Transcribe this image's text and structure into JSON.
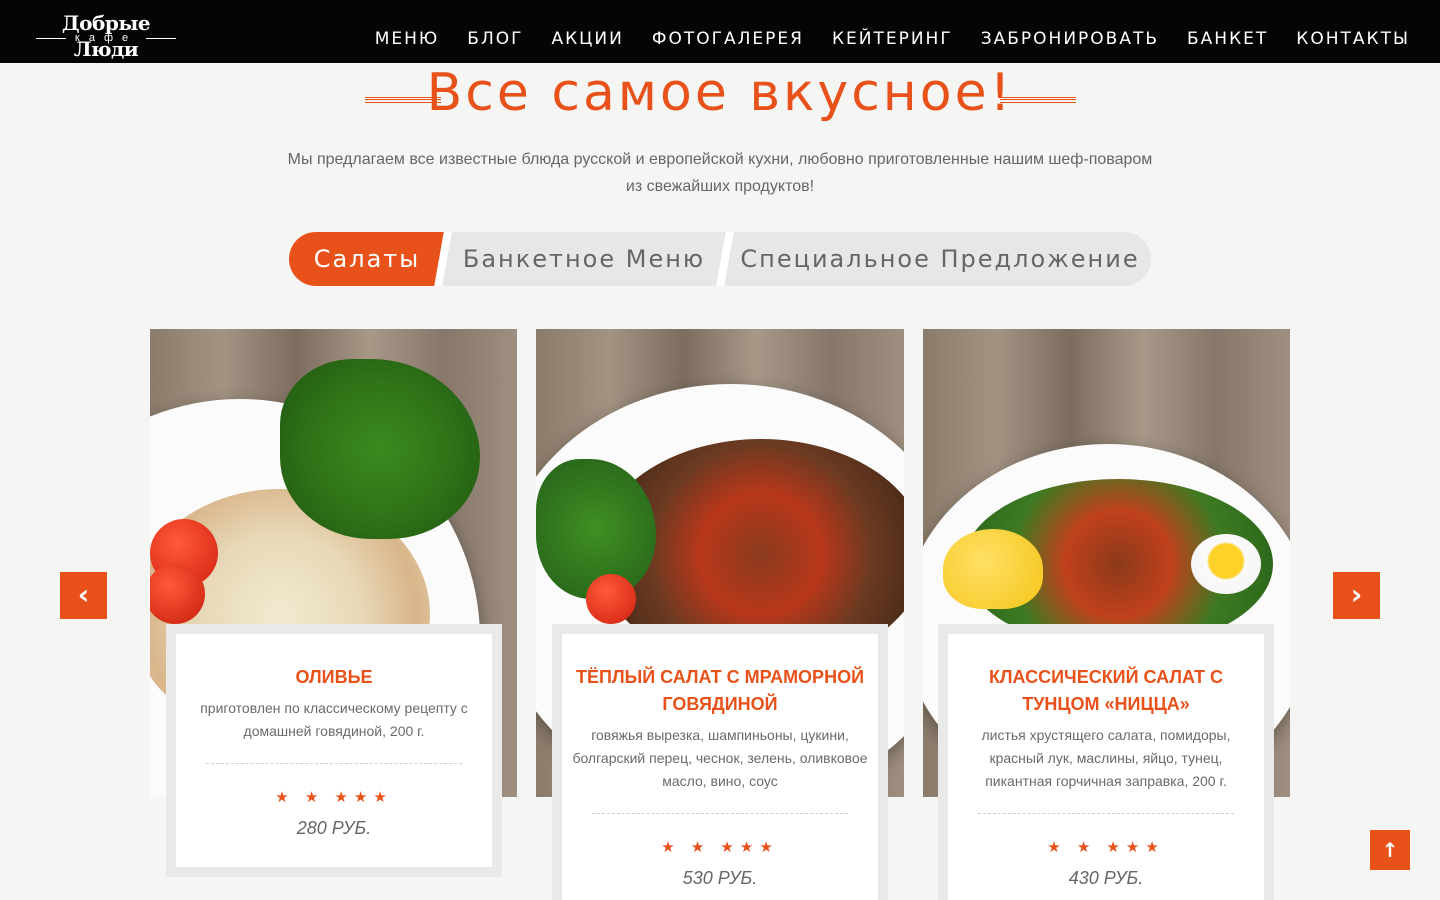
{
  "brand": {
    "name": "Добрые Люди",
    "sub": "кафе"
  },
  "nav": [
    "МЕНЮ",
    "БЛОГ",
    "АКЦИИ",
    "ФОТОГАЛЕРЕЯ",
    "КЕЙТЕРИНГ",
    "ЗАБРОНИРОВАТЬ",
    "БАНКЕТ",
    "КОНТАКТЫ"
  ],
  "section": {
    "title": "Все самое вкусное!",
    "subtitle_line1": "Мы предлагаем все известные блюда русской и европейской кухни, любовно приготовленные нашим шеф-поваром",
    "subtitle_line2": "из свежайших продуктов!"
  },
  "tabs": [
    "Салаты",
    "Банкетное Меню",
    "Специальное Предложение"
  ],
  "active_tab": "Салаты",
  "cards": [
    {
      "name": "Оливье",
      "desc": "приготовлен по классическому рецепту с домашней говядиной, 200 г.",
      "stars": "★ ★ ★★★",
      "rating": 5,
      "price": "280 РУБ."
    },
    {
      "name": "Тёплый салат с мраморной говядиной",
      "desc": "говяжья вырезка, шампиньоны, цукини, болгарский перец, чеснок, зелень, оливковое масло, вино, соус",
      "stars": "★ ★ ★★★",
      "rating": 5,
      "price": "530 РУБ."
    },
    {
      "name": "Классический салат с тунцом «Ницца»",
      "desc": "листья хрустящего салата, помидоры, красный лук, маслины, яйцо, тунец, пикантная горчичная заправка, 200 г.",
      "stars": "★ ★ ★★★",
      "rating": 5,
      "price": "430 РУБ."
    }
  ],
  "controls": {
    "prev": "‹",
    "next": "›",
    "top": "↑"
  },
  "colors": {
    "accent": "#e8521a",
    "header": "#050505"
  }
}
